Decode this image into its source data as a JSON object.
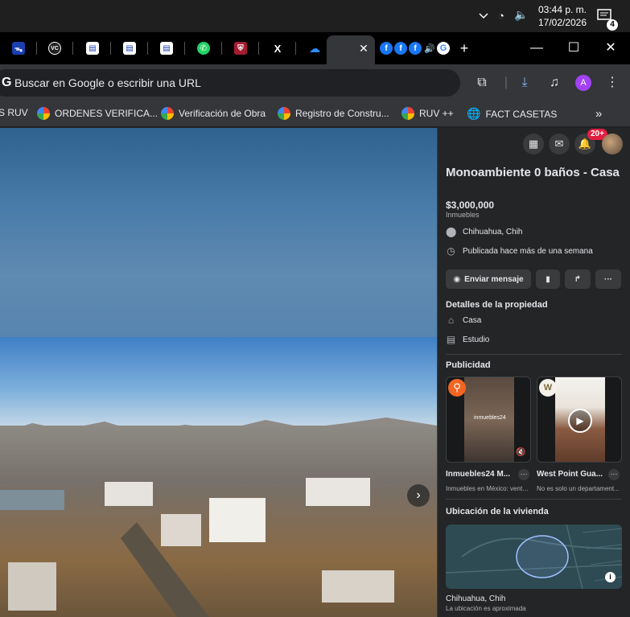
{
  "taskbar": {
    "time": "03:44 p. m.",
    "date": "17/02/2026",
    "notifications_count": "4"
  },
  "omnibox": {
    "google_letter": "G",
    "placeholder": "Buscar en Google o escribir una URL"
  },
  "avatar_letter": "A",
  "bookmarks": [
    {
      "label": "S RUV"
    },
    {
      "label": "ORDENES VERIFICA..."
    },
    {
      "label": "Verificación de Obra"
    },
    {
      "label": "Registro de Constru..."
    },
    {
      "label": "RUV ++"
    },
    {
      "label": "FACT CASETAS"
    }
  ],
  "fb": {
    "notif_badge": "20+",
    "listing": {
      "title": "Monoambiente 0 baños - Casa",
      "price": "$3,000,000",
      "category": "Inmuebles",
      "location": "Chihuahua, Chih",
      "published": "Publicada hace más de una semana"
    },
    "actions": {
      "message": "Enviar mensaje",
      "more": "···"
    },
    "details": {
      "heading": "Detalles de la propiedad",
      "type": "Casa",
      "layout": "Estudio"
    },
    "ads": {
      "heading": "Publicidad",
      "items": [
        {
          "title": "Inmuebles24 M...",
          "subtitle": "Inmuebles en México: venta ...",
          "brand": "inmuebles24"
        },
        {
          "title": "West Point Gua...",
          "subtitle": "No es solo un departament..."
        }
      ]
    },
    "map": {
      "heading": "Ubicación de la vivienda",
      "city": "Chihuahua, Chih",
      "note": "La ubicación es aproximada"
    }
  }
}
